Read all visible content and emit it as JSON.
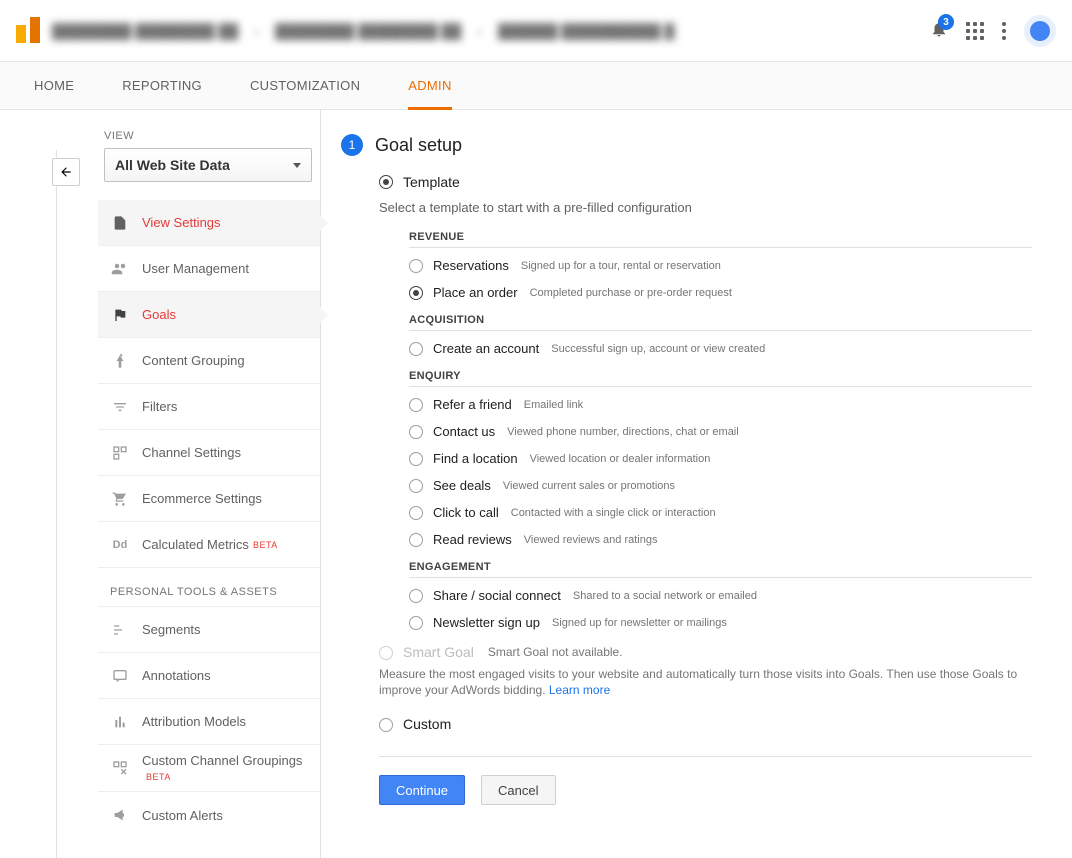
{
  "header": {
    "breadcrumb": [
      "████████ ████████ ██",
      "████████ ████████ ██",
      "██████ ██████████ █"
    ],
    "notif_count": "3"
  },
  "tabs": [
    "HOME",
    "REPORTING",
    "CUSTOMIZATION",
    "ADMIN"
  ],
  "active_tab": 3,
  "sidebar": {
    "view_label": "VIEW",
    "view_select": "All Web Site Data",
    "nav_items": [
      {
        "label": "View Settings",
        "active": true
      },
      {
        "label": "User Management"
      },
      {
        "label": "Goals",
        "active": true
      },
      {
        "label": "Content Grouping"
      },
      {
        "label": "Filters"
      },
      {
        "label": "Channel Settings"
      },
      {
        "label": "Ecommerce Settings"
      },
      {
        "label": "Calculated Metrics",
        "beta": "BETA"
      }
    ],
    "section_label": "PERSONAL TOOLS & ASSETS",
    "personal_items": [
      {
        "label": "Segments"
      },
      {
        "label": "Annotations"
      },
      {
        "label": "Attribution Models"
      },
      {
        "label": "Custom Channel Groupings",
        "beta": "BETA"
      },
      {
        "label": "Custom Alerts"
      }
    ]
  },
  "main": {
    "step_num": "1",
    "step_title": "Goal setup",
    "template_label": "Template",
    "template_hint": "Select a template to start with a pre-filled configuration",
    "groups": [
      {
        "title": "REVENUE",
        "options": [
          {
            "label": "Reservations",
            "desc": "Signed up for a tour, rental or reservation"
          },
          {
            "label": "Place an order",
            "desc": "Completed purchase or pre-order request",
            "selected": true
          }
        ]
      },
      {
        "title": "ACQUISITION",
        "options": [
          {
            "label": "Create an account",
            "desc": "Successful sign up, account or view created"
          }
        ]
      },
      {
        "title": "ENQUIRY",
        "options": [
          {
            "label": "Refer a friend",
            "desc": "Emailed link"
          },
          {
            "label": "Contact us",
            "desc": "Viewed phone number, directions, chat or email"
          },
          {
            "label": "Find a location",
            "desc": "Viewed location or dealer information"
          },
          {
            "label": "See deals",
            "desc": "Viewed current sales or promotions"
          },
          {
            "label": "Click to call",
            "desc": "Contacted with a single click or interaction"
          },
          {
            "label": "Read reviews",
            "desc": "Viewed reviews and ratings"
          }
        ]
      },
      {
        "title": "ENGAGEMENT",
        "options": [
          {
            "label": "Share / social connect",
            "desc": "Shared to a social network or emailed"
          },
          {
            "label": "Newsletter sign up",
            "desc": "Signed up for newsletter or mailings"
          }
        ]
      }
    ],
    "smart_label": "Smart Goal",
    "smart_avail": "Smart Goal not available.",
    "smart_desc": "Measure the most engaged visits to your website and automatically turn those visits into Goals. Then use those Goals to improve your AdWords bidding.",
    "learn_more": "Learn more",
    "custom_label": "Custom",
    "continue_btn": "Continue",
    "cancel_btn": "Cancel"
  }
}
